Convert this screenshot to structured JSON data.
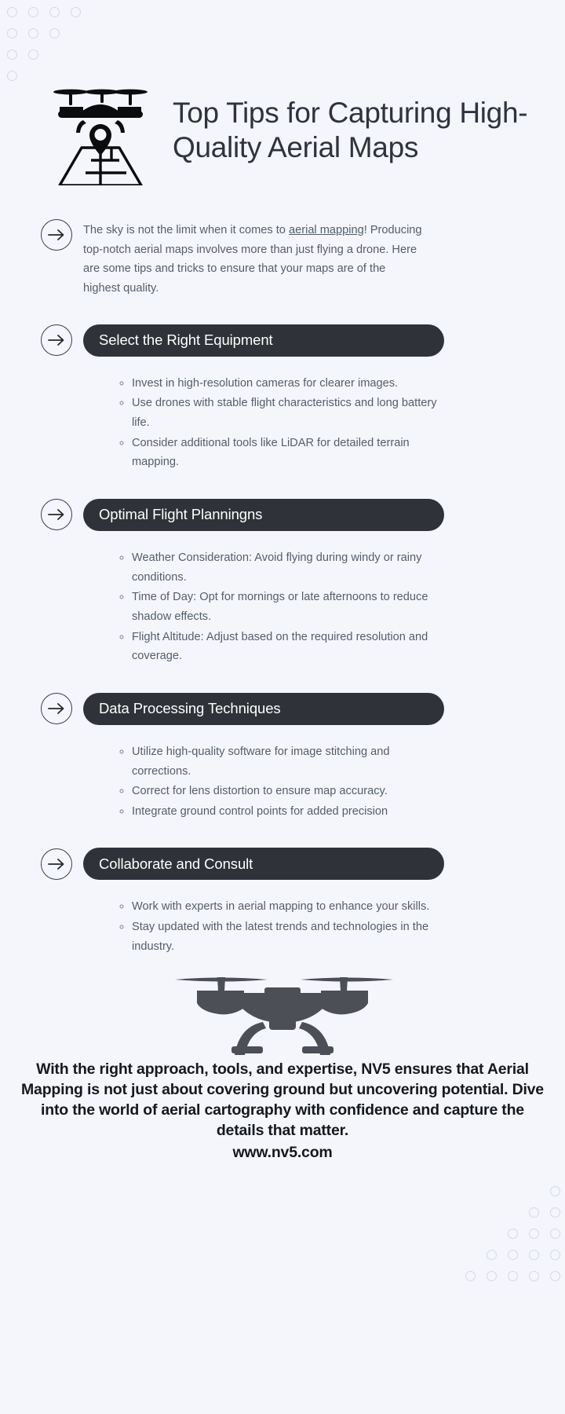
{
  "page": {
    "background_color": "#f4f6fc",
    "accent_dark": "#2f3238",
    "body_text_color": "#565d69",
    "title_color": "#2e333d"
  },
  "header": {
    "icon": "drone-over-map-icon",
    "title": "Top Tips for Capturing High-Quality Aerial Maps"
  },
  "intro": {
    "arrow_icon": "arrow-right-circle-icon",
    "text_before": "The sky is not the limit when it comes to ",
    "link_text": "aerial mapping",
    "text_after": "! Producing top-notch aerial maps involves more than just flying a drone. Here are some tips and tricks to ensure that your maps are of the highest quality."
  },
  "sections": [
    {
      "heading": "Select the Right Equipment",
      "arrow_icon": "arrow-right-circle-icon",
      "points": [
        "Invest in high-resolution cameras for clearer images.",
        "Use drones with stable flight characteristics and long battery life.",
        "Consider additional tools like LiDAR for detailed terrain mapping."
      ]
    },
    {
      "heading": "Optimal Flight Planningns",
      "arrow_icon": "arrow-right-circle-icon",
      "points": [
        "Weather Consideration: Avoid flying during windy or rainy conditions.",
        "Time of Day: Opt for mornings or late afternoons to reduce shadow effects.",
        "Flight Altitude: Adjust based on the required resolution and coverage."
      ]
    },
    {
      "heading": "Data Processing Techniques",
      "arrow_icon": "arrow-right-circle-icon",
      "points": [
        "Utilize high-quality software for image stitching and corrections.",
        "Correct for lens distortion to ensure map accuracy.",
        "Integrate ground control points for added precision"
      ]
    },
    {
      "heading": "Collaborate and Consult",
      "arrow_icon": "arrow-right-circle-icon",
      "points": [
        "Work with experts in aerial mapping to enhance your skills.",
        "Stay updated with the latest trends and technologies in the industry."
      ]
    }
  ],
  "drone_illustration": {
    "icon": "drone-silhouette-icon",
    "color": "#4c4f55"
  },
  "footer": {
    "statement": "With the right approach, tools, and expertise, NV5 ensures that Aerial Mapping is not just about covering ground but uncovering potential. Dive into the world of aerial cartography with confidence and capture the details that matter.",
    "url": "www.nv5.com"
  },
  "decoration": {
    "dot_color": "#d4d9e8",
    "top_left_rows": [
      4,
      3,
      2,
      1
    ],
    "bottom_right_rows": [
      1,
      2,
      3,
      4,
      5
    ]
  }
}
